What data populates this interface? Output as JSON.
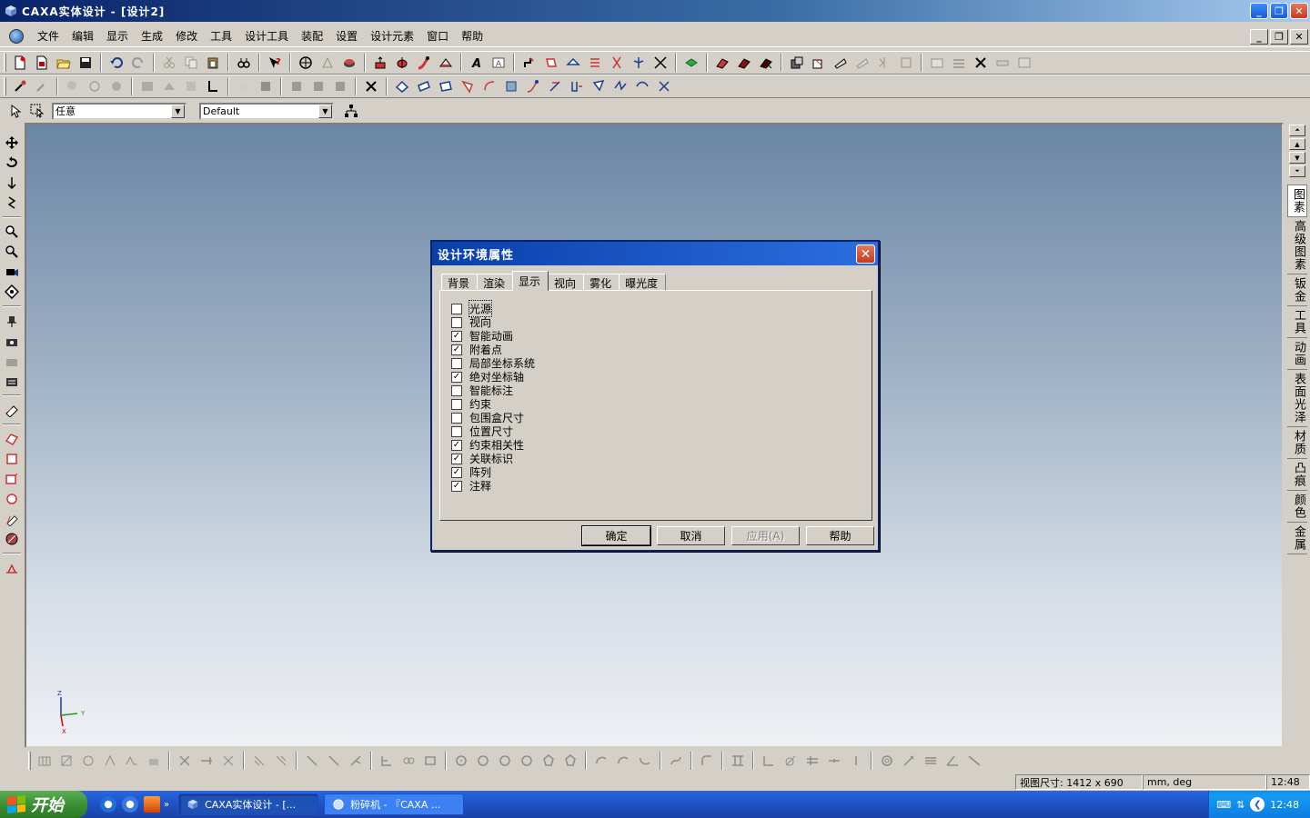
{
  "window": {
    "title": "CAXA实体设计 - [设计2]"
  },
  "menu": [
    "文件",
    "编辑",
    "显示",
    "生成",
    "修改",
    "工具",
    "设计工具",
    "装配",
    "设置",
    "设计元素",
    "窗口",
    "帮助"
  ],
  "selection_bar": {
    "filter_value": "任意",
    "style_value": "Default"
  },
  "right_tabs": [
    "图素",
    "高级图素",
    "钣金",
    "工具",
    "动画",
    "表面光泽",
    "材质",
    "凸痕",
    "颜色",
    "金属"
  ],
  "axis": {
    "z": "Z",
    "y": "Y",
    "x": "X"
  },
  "dialog": {
    "title": "设计环境属性",
    "tabs": [
      "背景",
      "渲染",
      "显示",
      "视向",
      "雾化",
      "曝光度"
    ],
    "active_tab": "显示",
    "options": [
      {
        "label": "光源",
        "checked": false
      },
      {
        "label": "视向",
        "checked": false
      },
      {
        "label": "智能动画",
        "checked": true
      },
      {
        "label": "附着点",
        "checked": true
      },
      {
        "label": "局部坐标系统",
        "checked": false
      },
      {
        "label": "绝对坐标轴",
        "checked": true
      },
      {
        "label": "智能标注",
        "checked": false
      },
      {
        "label": "约束",
        "checked": false
      },
      {
        "label": "包围盒尺寸",
        "checked": false
      },
      {
        "label": "位置尺寸",
        "checked": false
      },
      {
        "label": "约束相关性",
        "checked": true
      },
      {
        "label": "关联标识",
        "checked": true
      },
      {
        "label": "阵列",
        "checked": true
      },
      {
        "label": "注释",
        "checked": true
      }
    ],
    "buttons": {
      "ok": "确定",
      "cancel": "取消",
      "apply": "应用(A)",
      "help": "帮助"
    }
  },
  "status": {
    "view_size": "视图尺寸: 1412 x 690",
    "units": "mm, deg",
    "time": "12:48"
  },
  "taskbar": {
    "start": "开始",
    "tasks": [
      "CAXA实体设计 - [...",
      "粉碎机 - 『CAXA ..."
    ],
    "clock": "12:48"
  },
  "colors": {
    "canvas_top": "#6a86a4",
    "canvas_bottom": "#eef0f4",
    "dialog_title": "#0a3fa8",
    "taskbar": "#245edb",
    "start": "#3c8f35"
  }
}
